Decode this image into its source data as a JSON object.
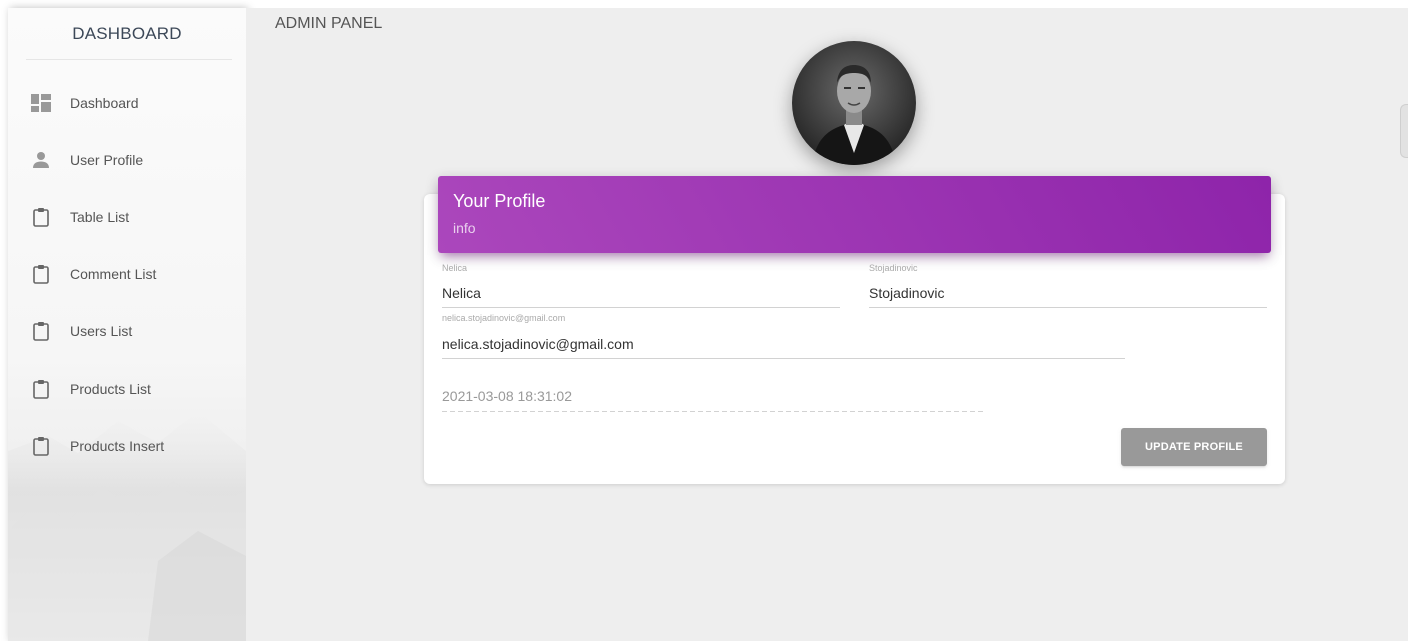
{
  "sidebar": {
    "brand": "DASHBOARD",
    "items": [
      {
        "label": "Dashboard",
        "icon": "dashboard-icon"
      },
      {
        "label": "User Profile",
        "icon": "person-icon"
      },
      {
        "label": "Table List",
        "icon": "clipboard-icon"
      },
      {
        "label": "Comment List",
        "icon": "clipboard-icon"
      },
      {
        "label": "Users List",
        "icon": "clipboard-icon"
      },
      {
        "label": "Products List",
        "icon": "clipboard-icon"
      },
      {
        "label": "Products Insert",
        "icon": "clipboard-icon"
      }
    ]
  },
  "topbar": {
    "title": "ADMIN PANEL"
  },
  "profile": {
    "avatar_alt": "profile-photo",
    "header_title": "Your Profile",
    "header_subtitle": "info",
    "first_name": {
      "label": "Nelica",
      "value": "Nelica"
    },
    "last_name": {
      "label": "Stojadinovic",
      "value": "Stojadinovic"
    },
    "email": {
      "label": "nelica.stojadinovic@gmail.com",
      "value": "nelica.stojadinovic@gmail.com"
    },
    "date": "2021-03-08 18:31:02",
    "update_button": "UPDATE PROFILE"
  },
  "colors": {
    "accent": "#9c27b0",
    "button": "#999999"
  }
}
